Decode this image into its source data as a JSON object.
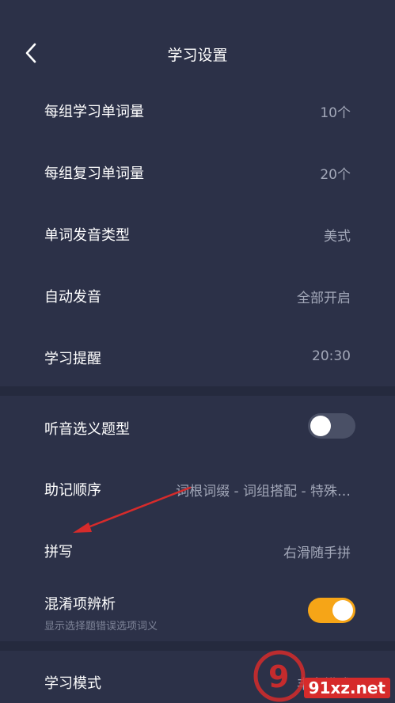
{
  "header": {
    "title": "学习设置",
    "back_icon": "chevron-left-icon"
  },
  "group1": {
    "items": [
      {
        "label": "每组学习单词量",
        "value": "10个"
      },
      {
        "label": "每组复习单词量",
        "value": "20个"
      },
      {
        "label": "单词发音类型",
        "value": "美式"
      },
      {
        "label": "自动发音",
        "value": "全部开启"
      },
      {
        "label": "学习提醒",
        "value": "20:30"
      }
    ]
  },
  "group2": {
    "listening": {
      "label": "听音选义题型",
      "toggle": "off"
    },
    "mnemonic": {
      "label": "助记顺序",
      "value": "词根词缀 - 词组搭配 - 特殊…"
    },
    "spelling": {
      "label": "拼写",
      "value": "右滑随手拼"
    },
    "confusion": {
      "label": "混淆项辨析",
      "sub": "显示选择题错误选项词义",
      "toggle": "on"
    }
  },
  "group3": {
    "mode": {
      "label": "学习模式",
      "value": "丰富模式"
    }
  },
  "colors": {
    "background": "#2c3148",
    "separator": "#252a3e",
    "toggle_on": "#f6a517",
    "toggle_off": "#4a5066",
    "annotation_arrow": "#d62b2b"
  },
  "watermark": {
    "text": "91xz.net"
  }
}
